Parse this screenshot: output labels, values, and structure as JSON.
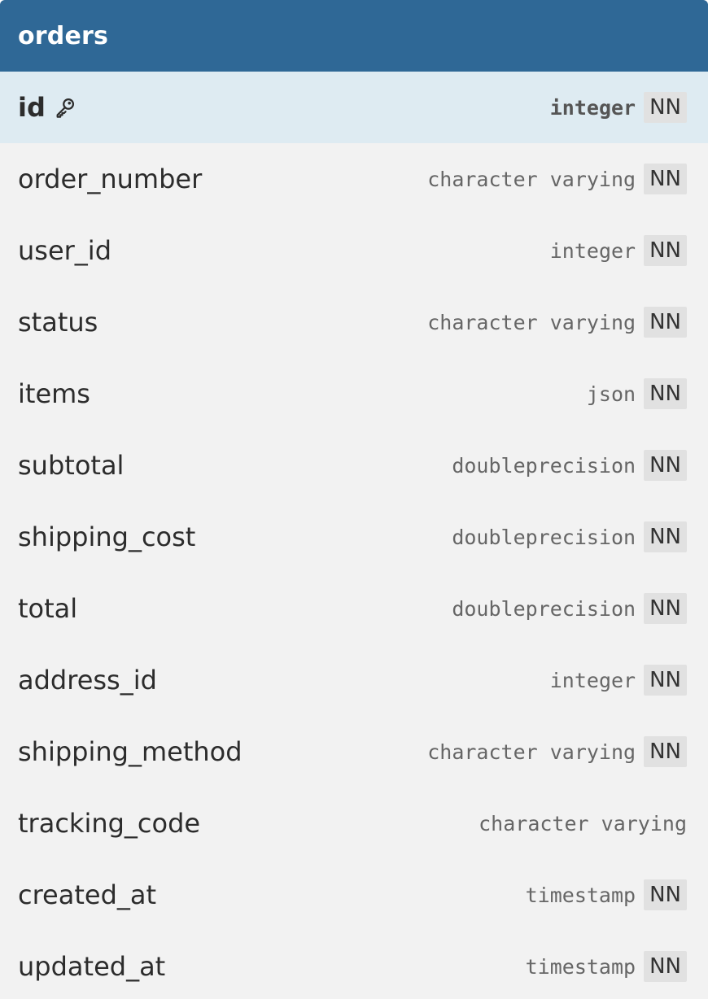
{
  "table": {
    "name": "orders",
    "columns": [
      {
        "name": "id",
        "type": "integer",
        "not_null": "NN",
        "primary_key": true,
        "icon": "key-icon"
      },
      {
        "name": "order_number",
        "type": "character varying",
        "not_null": "NN"
      },
      {
        "name": "user_id",
        "type": "integer",
        "not_null": "NN"
      },
      {
        "name": "status",
        "type": "character varying",
        "not_null": "NN"
      },
      {
        "name": "items",
        "type": "json",
        "not_null": "NN"
      },
      {
        "name": "subtotal",
        "type": "doubleprecision",
        "not_null": "NN"
      },
      {
        "name": "shipping_cost",
        "type": "doubleprecision",
        "not_null": "NN"
      },
      {
        "name": "total",
        "type": "doubleprecision",
        "not_null": "NN"
      },
      {
        "name": "address_id",
        "type": "integer",
        "not_null": "NN"
      },
      {
        "name": "shipping_method",
        "type": "character varying",
        "not_null": "NN"
      },
      {
        "name": "tracking_code",
        "type": "character varying",
        "not_null": ""
      },
      {
        "name": "created_at",
        "type": "timestamp",
        "not_null": "NN"
      },
      {
        "name": "updated_at",
        "type": "timestamp",
        "not_null": "NN"
      }
    ]
  },
  "colors": {
    "header": "#2f6896",
    "pk_row": "#deebf2",
    "body": "#f2f2f2",
    "badge": "#e1e1e1"
  }
}
